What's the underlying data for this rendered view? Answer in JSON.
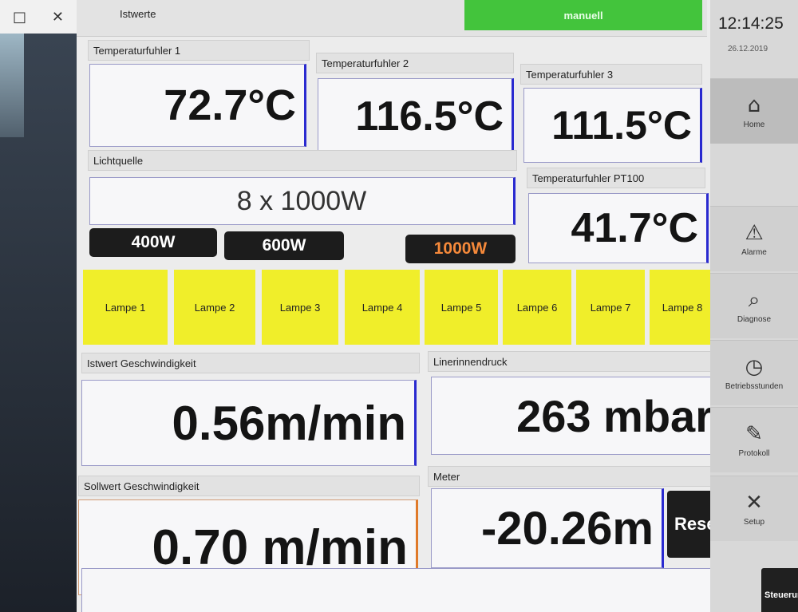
{
  "host_window": {
    "maximize_glyph": "□",
    "close_glyph": "✕"
  },
  "header": {
    "caption": "Istwerte",
    "mode_button": "manuell"
  },
  "clock": {
    "time": "12:14:25",
    "date": "26.12.2019"
  },
  "temperature": {
    "t1": {
      "label": "Temperaturfuhler 1",
      "value": "72.7°C"
    },
    "t2": {
      "label": "Temperaturfuhler 2",
      "value": "116.5°C"
    },
    "t3": {
      "label": "Temperaturfuhler 3",
      "value": "111.5°C"
    },
    "pt100": {
      "label": "Temperaturfuhler PT100",
      "value": "41.7°C"
    }
  },
  "light": {
    "label": "Lichtquelle",
    "value": "8 x 1000W",
    "power_buttons": [
      {
        "label": "400W",
        "active": false
      },
      {
        "label": "600W",
        "active": false
      },
      {
        "label": "1000W",
        "active": true
      }
    ],
    "lamps": [
      "Lampe 1",
      "Lampe 2",
      "Lampe 3",
      "Lampe 4",
      "Lampe 5",
      "Lampe 6",
      "Lampe 7",
      "Lampe 8"
    ],
    "lamp_color": "#f0ee2a"
  },
  "speed_actual": {
    "label": "Istwert Geschwindigkeit",
    "value": "0.56m/min"
  },
  "pressure": {
    "label": "Linerinnendruck",
    "value": "263 mbar"
  },
  "speed_setpoint": {
    "label": "Sollwert Geschwindigkeit",
    "value": "0.70 m/min"
  },
  "meter": {
    "label": "Meter",
    "value": "-20.26m",
    "reset_label": "Reset"
  },
  "nav": {
    "items": [
      {
        "icon": "home-icon",
        "glyph": "⌂",
        "label": "Home"
      },
      {
        "icon": "warning-icon",
        "glyph": "⚠",
        "label": "Alarme"
      },
      {
        "icon": "magnifier-icon",
        "glyph": "⌕",
        "label": "Diagnose"
      },
      {
        "icon": "clock-icon",
        "glyph": "◷",
        "label": "Betriebsstunden"
      },
      {
        "icon": "protocol-icon",
        "glyph": "✎",
        "label": "Protokoll"
      },
      {
        "icon": "tools-icon",
        "glyph": "✕",
        "label": "Setup"
      }
    ],
    "control_button": "Steuerung Ein"
  },
  "colors": {
    "accent_green": "#43c43c",
    "lamp_yellow": "#f0ee2a",
    "active_orange": "#f5893a"
  }
}
